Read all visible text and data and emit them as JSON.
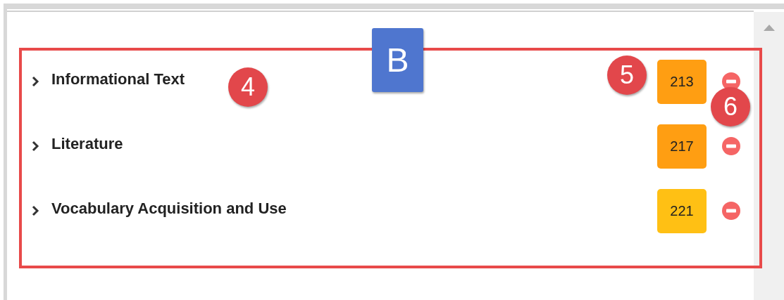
{
  "rows": [
    {
      "label": "Informational Text",
      "expanded": false,
      "score": "213",
      "color": "#ff9e12"
    },
    {
      "label": "Literature",
      "expanded": false,
      "score": "217",
      "color": "#ff9e12"
    },
    {
      "label": "Vocabulary Acquisition and Use",
      "expanded": false,
      "score": "221",
      "color": "#ffc014"
    }
  ],
  "annotations": [
    {
      "kind": "square",
      "label": "B"
    },
    {
      "kind": "circle",
      "label": "4"
    },
    {
      "kind": "circle",
      "label": "5"
    },
    {
      "kind": "circle",
      "label": "6"
    }
  ]
}
